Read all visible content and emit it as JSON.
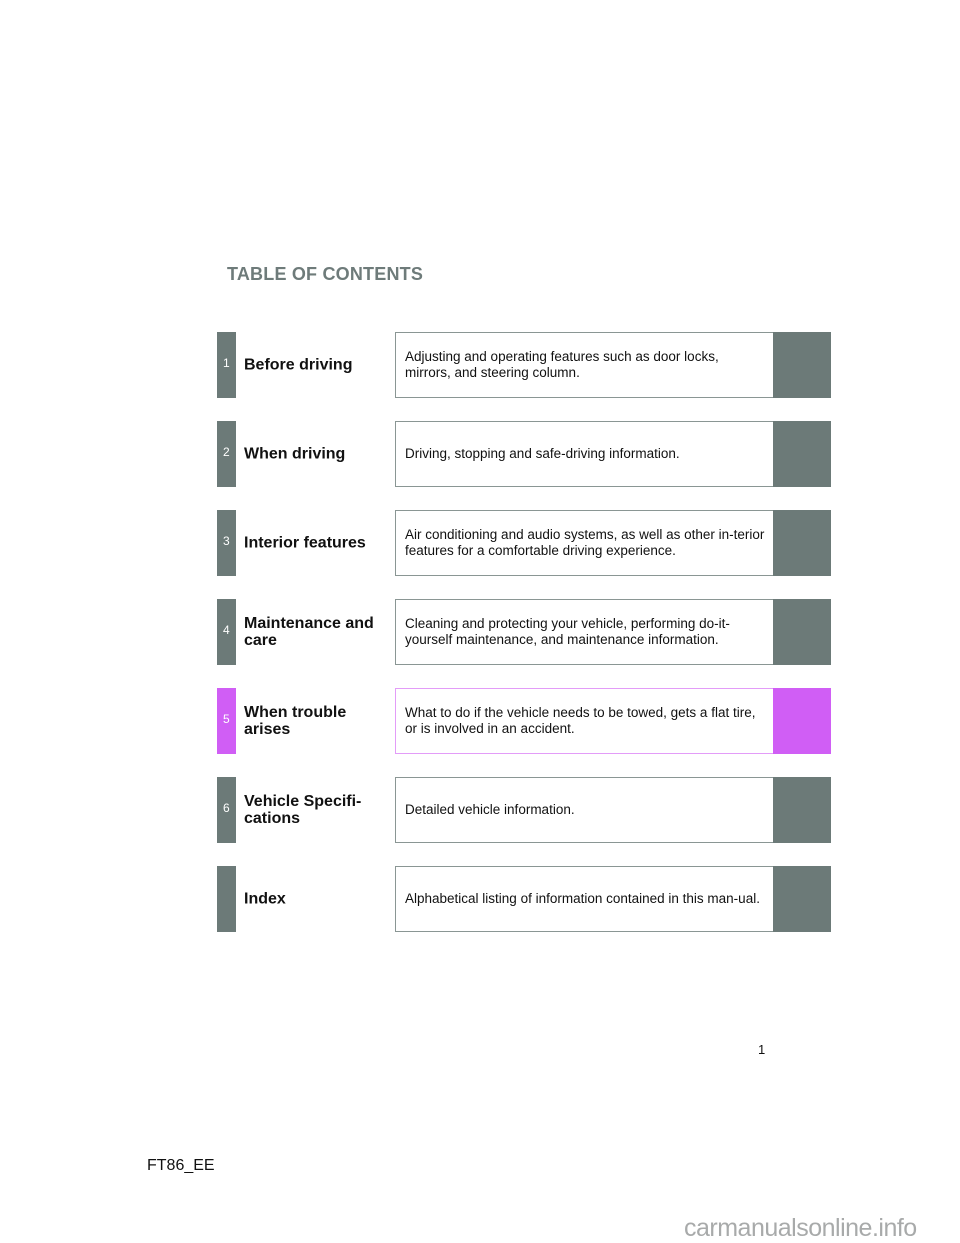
{
  "page": {
    "title": "TABLE OF CONTENTS",
    "page_number": "1",
    "document_code": "FT86_EE",
    "watermark": "carmanualsonline.info"
  },
  "colors": {
    "section_gray": "#6c7a78",
    "section_active": "#d05ef5",
    "title_color": "#6e7b7a"
  },
  "sections": [
    {
      "number": "1",
      "heading": "Before driving",
      "description": "Adjusting and operating features such as door locks, mirrors, and steering column.",
      "active": false
    },
    {
      "number": "2",
      "heading": "When driving",
      "description": "Driving, stopping and safe-driving information.",
      "active": false
    },
    {
      "number": "3",
      "heading": "Interior features",
      "description": "Air conditioning and audio systems, as well as other in-terior features for a comfortable driving experience.",
      "active": false
    },
    {
      "number": "4",
      "heading": "Maintenance and care",
      "description": "Cleaning and protecting your vehicle, performing do-it-yourself maintenance, and maintenance information.",
      "active": false
    },
    {
      "number": "5",
      "heading": "When trouble arises",
      "description": "What to do if the vehicle needs to be towed, gets a flat tire, or is involved in an accident.",
      "active": true
    },
    {
      "number": "6",
      "heading": "Vehicle Specifi-cations",
      "description": "Detailed vehicle information.",
      "active": false
    },
    {
      "number": "",
      "heading": "Index",
      "description": "Alphabetical listing of information contained in this man-ual.",
      "active": false
    }
  ]
}
